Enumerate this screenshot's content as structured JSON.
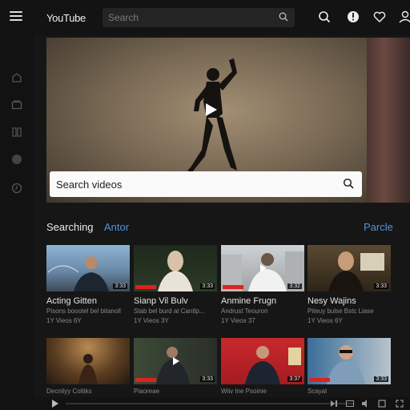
{
  "header": {
    "logo": "YouTube",
    "search_placeholder": "Search",
    "icons": [
      "menu-icon",
      "search-icon",
      "notification-icon",
      "heart-icon",
      "user-icon"
    ]
  },
  "sidebar": {
    "icons": [
      "home-icon",
      "subscriptions-icon",
      "library-icon",
      "circle-icon",
      "history-icon"
    ]
  },
  "hero": {
    "search_text": "Search videos"
  },
  "section": {
    "title": "Searching",
    "alt_link": "Antor",
    "right_link": "Parcle"
  },
  "videos_row1": [
    {
      "title": "Acting Gitten",
      "meta": "Pisons boootel bel bitanoll",
      "views": "1Y Vieos 6Y",
      "duration": "3:33"
    },
    {
      "title": "Sianp Vil Bulv",
      "meta": "Stab bel burd at Cantlp...",
      "views": "1Y Vieos 3Y",
      "duration": "3:33"
    },
    {
      "title": "Anmine Frugn",
      "meta": "Andrust Teouron",
      "views": "1Y Vieos 37",
      "duration": "3:32"
    },
    {
      "title": "Nesy Wajins",
      "meta": "Piteuy bulse Bstc Liase",
      "views": "1Y Vieos 6Y",
      "duration": "3:33"
    }
  ],
  "videos_row2": [
    {
      "title": "Decnilyy Coltiks",
      "duration": "3:33"
    },
    {
      "title": "Piaoreae",
      "duration": "3:33"
    },
    {
      "title": "Wiiv Ine Psoinie",
      "duration": "3:37"
    },
    {
      "title": "Scayal",
      "duration": "3:33"
    }
  ],
  "colors": {
    "accent_link": "#4e95d9",
    "background": "#161616",
    "red_badge": "#d22222"
  }
}
